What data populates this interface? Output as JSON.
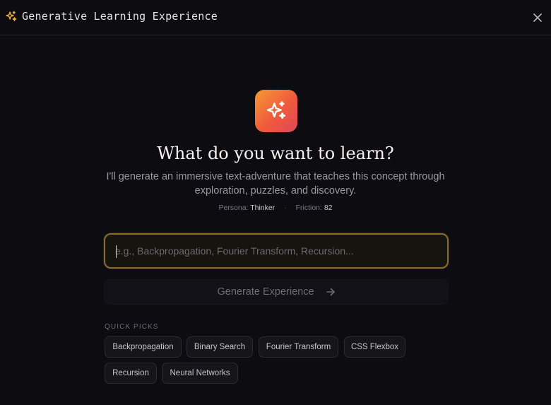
{
  "header": {
    "title": "Generative Learning Experience",
    "icon": "sparkles-icon",
    "close_icon": "close-icon"
  },
  "hero": {
    "icon": "sparkles-icon",
    "title": "What do you want to learn?",
    "subtitle": "I'll generate an immersive text-adventure that teaches this concept through exploration, puzzles, and discovery.",
    "persona_label": "Persona:",
    "persona_value": "Thinker",
    "separator": "·",
    "friction_label": "Friction:",
    "friction_value": "82"
  },
  "search": {
    "placeholder": "e.g., Backpropagation, Fourier Transform, Recursion...",
    "value": ""
  },
  "generate": {
    "label": "Generate Experience",
    "icon": "arrow-right-icon"
  },
  "quick_picks": {
    "label": "QUICK PICKS",
    "items": [
      "Backpropagation",
      "Binary Search",
      "Fourier Transform",
      "CSS Flexbox",
      "Recursion",
      "Neural Networks"
    ]
  },
  "colors": {
    "background": "#0d0c11",
    "accent_gradient_start": "#f79a33",
    "accent_gradient_end": "#e2465b",
    "input_border": "#8a6a2e",
    "header_icon": "#f2b233"
  }
}
